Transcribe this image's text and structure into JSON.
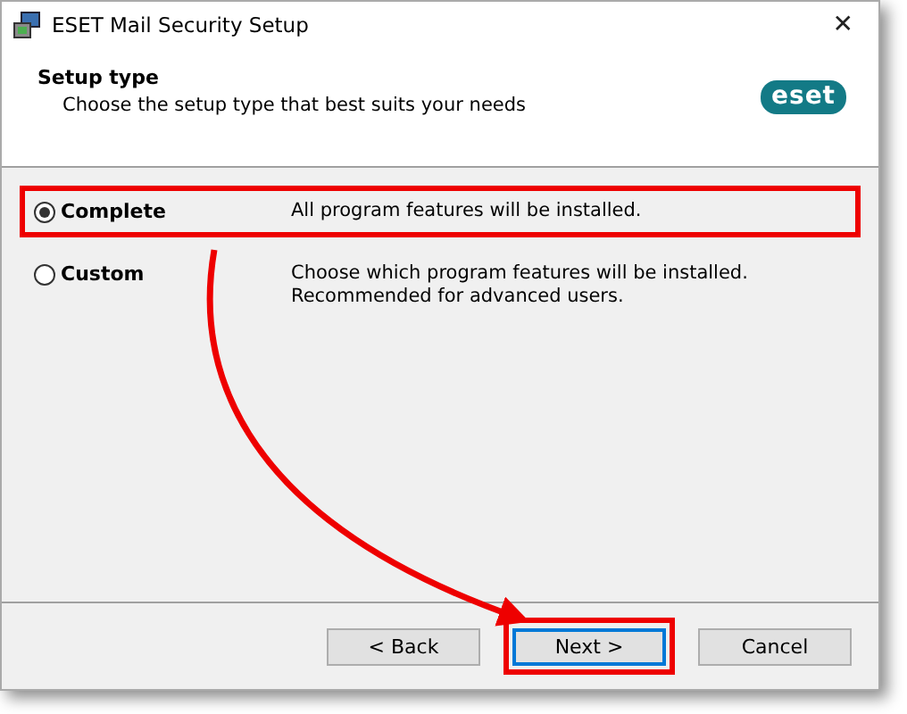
{
  "window": {
    "title": "ESET Mail Security Setup",
    "close": "✕"
  },
  "header": {
    "title": "Setup type",
    "subtitle": "Choose the setup type that best suits your needs",
    "logo": "eset"
  },
  "options": [
    {
      "label": "Complete",
      "description": "All program features will be installed.",
      "selected": true,
      "highlighted": true
    },
    {
      "label": "Custom",
      "description": "Choose which program features will be installed.\nRecommended for advanced users.",
      "selected": false,
      "highlighted": false
    }
  ],
  "buttons": [
    {
      "label": "< Back",
      "focused": false,
      "highlighted": false
    },
    {
      "label": "Next >",
      "focused": true,
      "highlighted": true
    },
    {
      "label": "Cancel",
      "focused": false,
      "highlighted": false
    }
  ]
}
